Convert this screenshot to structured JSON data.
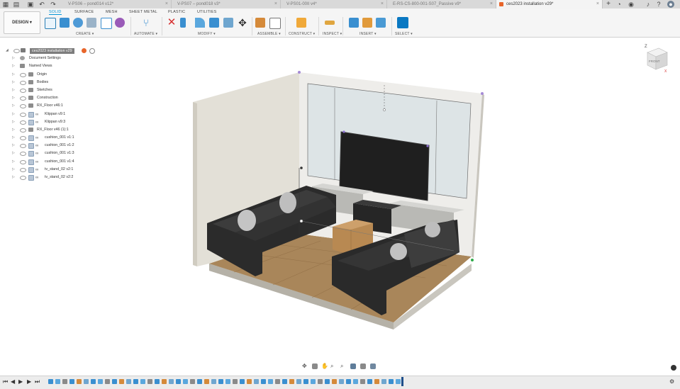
{
  "tabs": [
    {
      "label": "V-PS06 – pond014 v12*",
      "active": false
    },
    {
      "label": "V-PS07 – pond018 v3*",
      "active": false
    },
    {
      "label": "V-PS01-00II v4*",
      "active": false
    },
    {
      "label": "E-RS-CS-800-001-S07_Passive v9*",
      "active": false
    },
    {
      "label": "ces2023 installation v29*",
      "active": true
    }
  ],
  "ribbon": {
    "workspace_button": "DESIGN ▾",
    "tabs": [
      "SOLID",
      "SURFACE",
      "MESH",
      "SHEET METAL",
      "PLASTIC",
      "UTILITIES"
    ],
    "active_tab": "SOLID",
    "groups": [
      "CREATE ▾",
      "AUTOMATE ▾",
      "MODIFY ▾",
      "ASSEMBLE ▾",
      "CONSTRUCT ▾",
      "INSPECT ▾",
      "INSERT ▾",
      "SELECT ▾"
    ]
  },
  "browser": {
    "root": "ces2023 installation v29",
    "items": [
      {
        "label": "Document Settings",
        "type": "gear"
      },
      {
        "label": "Named Views",
        "type": "folder"
      },
      {
        "label": "Origin",
        "type": "folder"
      },
      {
        "label": "Bodies",
        "type": "folder"
      },
      {
        "label": "Sketches",
        "type": "folder"
      },
      {
        "label": "Construction",
        "type": "folder"
      },
      {
        "label": "RX_Floor v46:1",
        "type": "folder"
      },
      {
        "label": "Klippan v9:1",
        "type": "comp"
      },
      {
        "label": "Klippan v9:3",
        "type": "comp"
      },
      {
        "label": "RX_Floor v46 (1):1",
        "type": "folder"
      },
      {
        "label": "cushion_001 v1:1",
        "type": "comp"
      },
      {
        "label": "cushion_001 v1:2",
        "type": "comp"
      },
      {
        "label": "cushion_001 v1:3",
        "type": "comp"
      },
      {
        "label": "cushion_001 v1:4",
        "type": "comp"
      },
      {
        "label": "tv_stand_02 v2:1",
        "type": "comp"
      },
      {
        "label": "tv_stand_02 v2:2",
        "type": "comp"
      }
    ]
  },
  "viewcube": {
    "face_label": "FRONT",
    "axis_z": "Z",
    "axis_x": "X"
  },
  "colors": {
    "accent": "#0696d7",
    "record": "#e8652a",
    "wall": "#eceae3",
    "floor": "#a9865a"
  }
}
